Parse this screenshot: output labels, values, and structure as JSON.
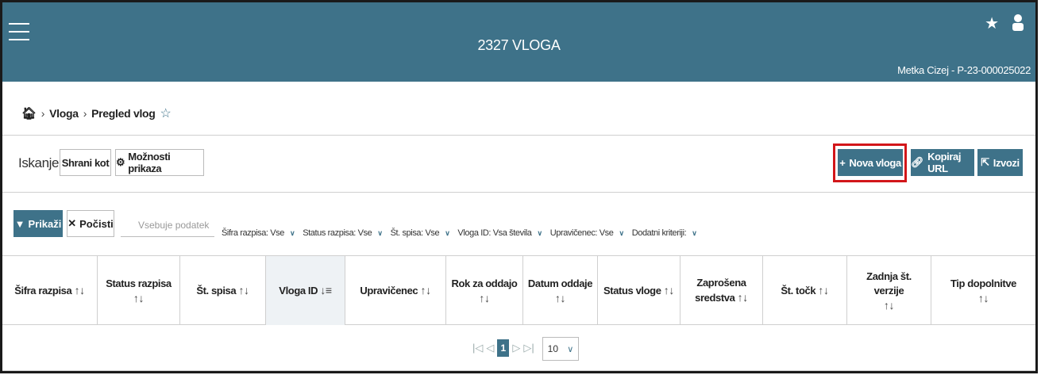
{
  "header": {
    "title": "2327 VLOGA",
    "user_info": "Metka Cizej - P-23-000025022",
    "icons": [
      "menu-icon",
      "star-icon",
      "user-icon"
    ]
  },
  "breadcrumb": {
    "items": [
      "Vloga",
      "Pregled vlog"
    ]
  },
  "toolbar": {
    "search_label": "Iskanje",
    "save_as_label": "Shrani kot",
    "display_options_label": "Možnosti prikaza",
    "new_application_label": "Nova vloga",
    "copy_url_label": "Kopiraj URL",
    "export_label": "Izvozi"
  },
  "filters": {
    "show_label": "Prikaži",
    "clear_label": "Počisti",
    "search_placeholder": "Vsebuje podatek",
    "items": [
      "Šifra razpisa: Vse",
      "Status razpisa: Vse",
      "Št. spisa: Vse",
      "Vloga ID: Vsa števila",
      "Upravičenec: Vse",
      "Dodatni kriteriji:"
    ]
  },
  "table": {
    "columns": [
      "Šifra razpisa",
      "Status razpisa",
      "Št. spisa",
      "Vloga ID",
      "Upravičenec",
      "Rok za oddajo",
      "Datum oddaje",
      "Status vloge",
      "Zaprošena sredstva",
      "Št. točk",
      "Zadnja št. verzije",
      "Tip dopolnitve"
    ]
  },
  "pagination": {
    "current_page": "1",
    "page_size": "10"
  },
  "colors": {
    "primary": "#3e7289",
    "highlight": "#d2161a"
  }
}
